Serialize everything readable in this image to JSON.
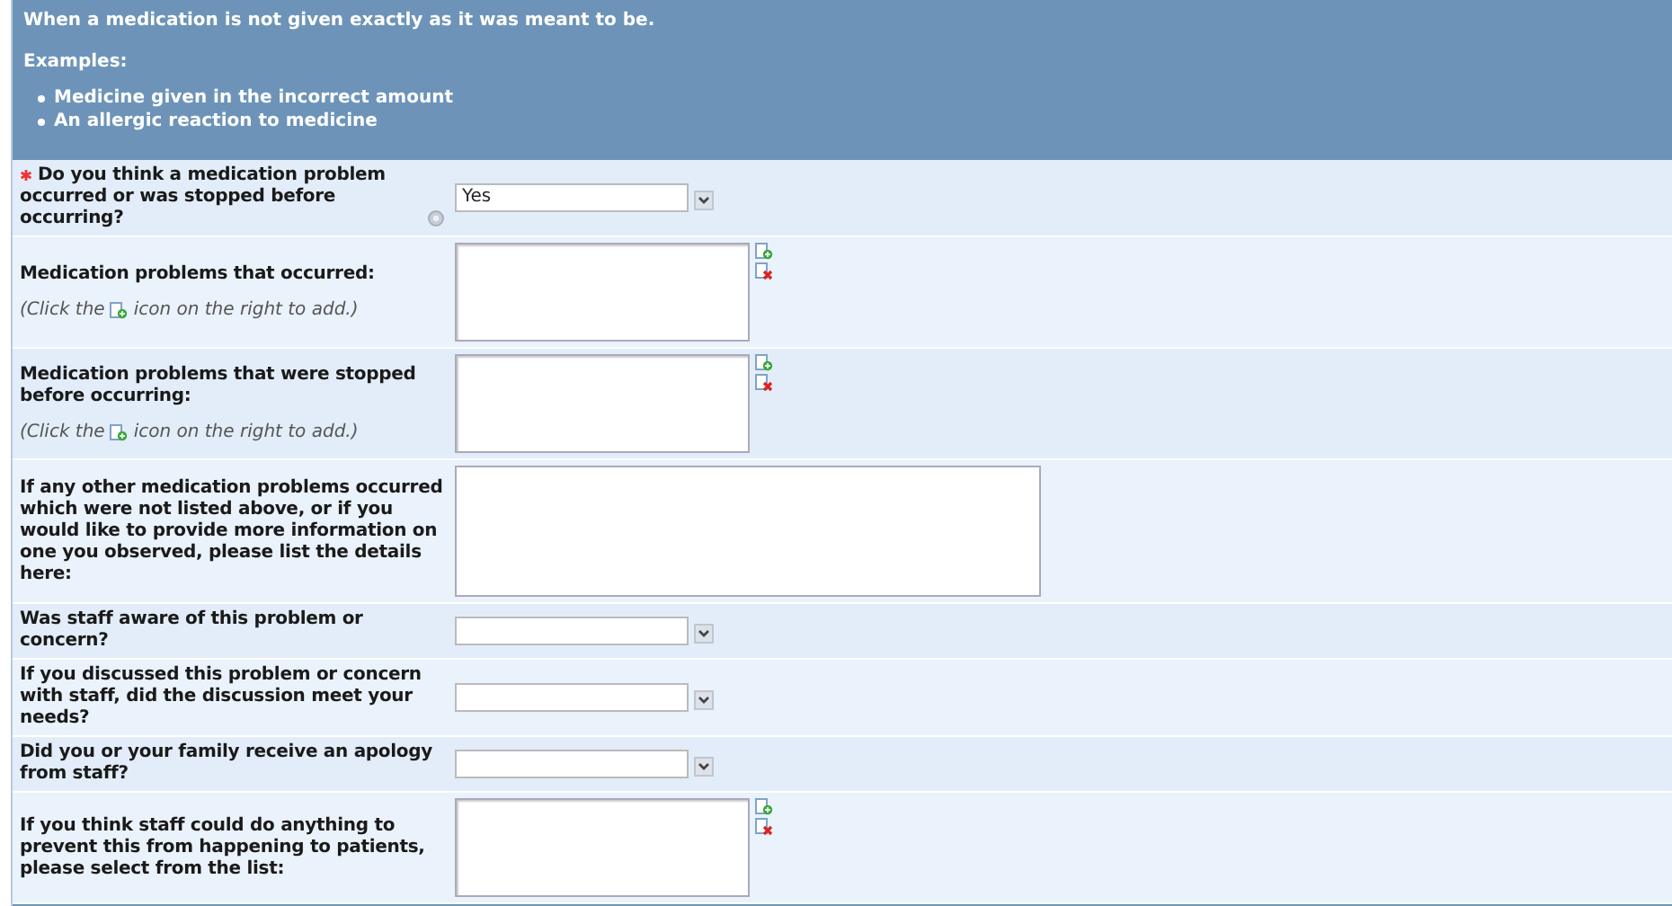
{
  "intro": {
    "text": "When a medication is not given exactly as it was meant to be.",
    "examples_label": "Examples:",
    "examples": [
      "Medicine given in the incorrect amount",
      "An allergic reaction to medicine"
    ]
  },
  "questions": [
    {
      "kind": "select",
      "required": true,
      "help": true,
      "label": "Do you think a medication problem occurred or was stopped before occurring?",
      "value": "Yes"
    },
    {
      "kind": "listbox",
      "required": false,
      "help": false,
      "label": "Medication problems that occurred:",
      "hint_before": "(Click the",
      "hint_after": "icon on the right to add.)"
    },
    {
      "kind": "listbox",
      "required": false,
      "help": false,
      "label": "Medication problems that were stopped before occurring:",
      "hint_before": "(Click the",
      "hint_after": "icon on the right to add.)"
    },
    {
      "kind": "textarea",
      "required": false,
      "help": false,
      "label": "If any other medication problems occurred which were not listed above, or if you would like to provide more information on one you observed, please list the details here:"
    },
    {
      "kind": "select",
      "required": false,
      "help": false,
      "label": "Was staff aware of this problem or concern?"
    },
    {
      "kind": "select",
      "required": false,
      "help": false,
      "label": "If you discussed this problem or concern with staff, did the discussion meet your needs?"
    },
    {
      "kind": "select",
      "required": false,
      "help": false,
      "label": "Did you or your family receive an apology from staff?"
    },
    {
      "kind": "listbox",
      "required": false,
      "help": false,
      "label": "If you think staff could do anything to prevent this from happening to patients, please select from the list:"
    }
  ]
}
